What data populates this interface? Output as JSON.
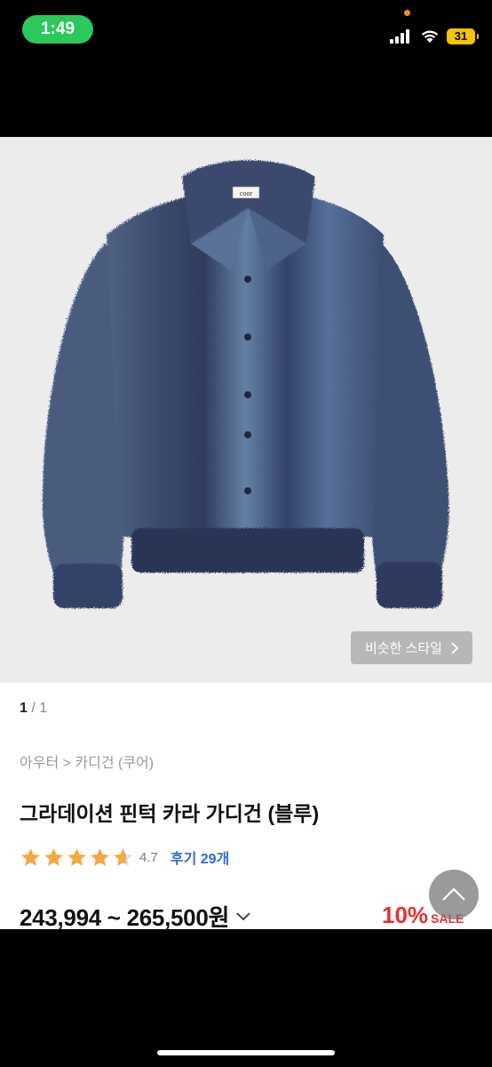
{
  "status_bar": {
    "time": "1:49",
    "battery": "31",
    "icons": [
      "signal-icon",
      "wifi-icon",
      "battery-icon"
    ]
  },
  "product": {
    "image_alt": "blue fuzzy cardigan jacket",
    "similar_style_label": "비슷한 스타일",
    "pager": {
      "current": "1",
      "separator": "/",
      "total": "1"
    },
    "breadcrumb": "아우터 > 카디건 (쿠어)",
    "title": "그라데이션 핀턱 카라 가디건 (블루)",
    "rating": 4.7,
    "rating_text": "4.7",
    "review_label": "후기 29개",
    "price": "243,994 ~ 265,500원",
    "discount_percent": "10%",
    "discount_label": "SALE",
    "brand_label": "coor"
  },
  "colors": {
    "status_pill": "#2bc95a",
    "battery": "#f5c400",
    "star": "#f5a742",
    "review_link": "#2d6bd6",
    "discount": "#e8312f"
  }
}
